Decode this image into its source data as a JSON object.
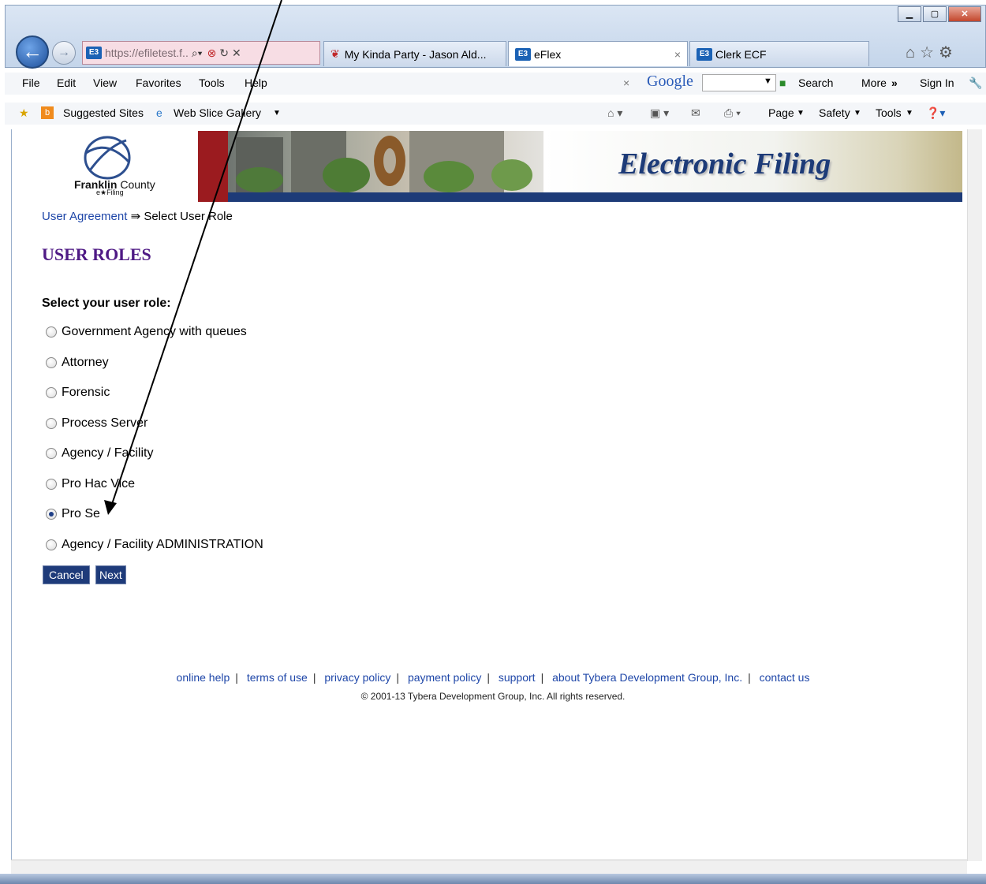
{
  "browser": {
    "address": "https://efiletest.f..",
    "tabs": [
      {
        "label": "My Kinda Party - Jason Ald..."
      },
      {
        "label": "eFlex"
      },
      {
        "label": "Clerk ECF"
      }
    ],
    "menu": [
      "File",
      "Edit",
      "View",
      "Favorites",
      "Tools",
      "Help"
    ],
    "google_label": "Google",
    "search_label": "Search",
    "more_label": "More",
    "signin_label": "Sign In",
    "favorites": [
      "Suggested Sites",
      "Web Slice Gallery"
    ],
    "command_items": [
      "Page",
      "Safety",
      "Tools"
    ]
  },
  "banner": {
    "title": "Electronic Filing",
    "logo_text_bold": "Franklin",
    "logo_text": "County",
    "logo_sub": "e★Filing"
  },
  "breadcrumb": {
    "link": "User Agreement",
    "separator": "⇛",
    "current": "Select User Role"
  },
  "page_title": "USER ROLES",
  "prompt": "Select your user role:",
  "roles": [
    {
      "label": "Government Agency with queues",
      "selected": false
    },
    {
      "label": "Attorney",
      "selected": false
    },
    {
      "label": "Forensic",
      "selected": false
    },
    {
      "label": "Process Server",
      "selected": false
    },
    {
      "label": "Agency / Facility",
      "selected": false
    },
    {
      "label": "Pro Hac Vice",
      "selected": false
    },
    {
      "label": "Pro Se",
      "selected": true
    },
    {
      "label": "Agency / Facility ADMINISTRATION",
      "selected": false
    }
  ],
  "buttons": {
    "cancel": "Cancel",
    "next": "Next"
  },
  "footer": {
    "links": [
      "online help",
      "terms of use",
      "privacy policy",
      "payment policy",
      "support",
      "about Tybera Development Group, Inc.",
      "contact us"
    ],
    "copyright": "© 2001-13 Tybera Development Group, Inc. All rights reserved."
  },
  "colors": {
    "title_purple": "#4f1a85",
    "banner_blue": "#1d3b78",
    "button_navy": "#1e3b7a",
    "link_blue": "#1e46a8"
  }
}
